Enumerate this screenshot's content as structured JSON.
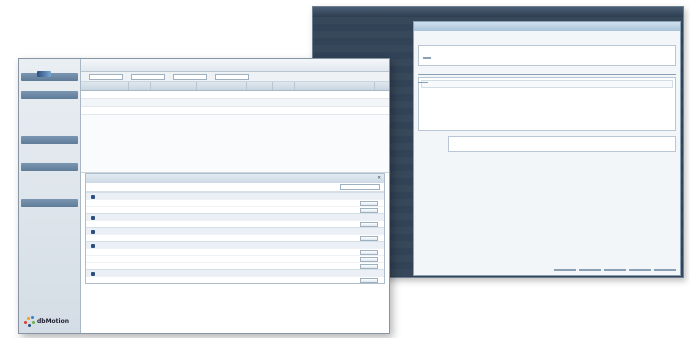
{
  "back_window": {
    "app_title": "",
    "dialog": {
      "title": "",
      "patient_header": "",
      "author_header": "",
      "patient_fields": [],
      "author_fields": [],
      "fields": [],
      "history_header": "",
      "history_lines": [],
      "history_button": "",
      "tab_label": "",
      "reply_header": "",
      "reply_text": "",
      "note_label": "",
      "buttons": [
        "",
        "",
        "",
        "",
        ""
      ]
    }
  },
  "front_window": {
    "title": "",
    "links": [
      "",
      "",
      ""
    ],
    "sidebar": {
      "items": [
        {
          "label": "",
          "style": "sec"
        },
        {
          "label": "",
          "style": "plain"
        },
        {
          "label": "",
          "style": "sec"
        },
        {
          "label": "",
          "style": "plain"
        },
        {
          "label": "",
          "style": "plain"
        },
        {
          "label": "",
          "style": "plain"
        },
        {
          "label": "",
          "style": "plain"
        },
        {
          "label": "",
          "style": "sec"
        },
        {
          "label": "",
          "style": "plain"
        },
        {
          "label": "",
          "style": "plain"
        },
        {
          "label": "",
          "style": "sec"
        },
        {
          "label": "",
          "style": "plain"
        },
        {
          "label": "",
          "style": "plain"
        },
        {
          "label": "",
          "style": "plain"
        },
        {
          "label": "",
          "style": "sec"
        },
        {
          "label": "",
          "style": "plain"
        }
      ],
      "brand": "dbMotion"
    },
    "filters": {
      "labels": [
        "",
        "",
        "",
        ""
      ],
      "values": [
        "",
        "",
        "",
        ""
      ]
    },
    "grid": {
      "columns": [
        "",
        "",
        "",
        "",
        "",
        "",
        ""
      ],
      "rows": [
        [
          "",
          "",
          "",
          "",
          "",
          "",
          ""
        ],
        [
          "",
          "",
          "",
          "",
          "",
          "",
          ""
        ],
        [
          "",
          "",
          "",
          "",
          "",
          "",
          ""
        ]
      ]
    },
    "messages": {
      "title": "",
      "filter_value": "",
      "groups": [
        {
          "header": "",
          "lines": [
            {
              "date": "",
              "text": "",
              "red": false,
              "action": ""
            },
            {
              "date": "",
              "text": "",
              "red": false,
              "action": ""
            }
          ]
        },
        {
          "header": "",
          "lines": [
            {
              "date": "",
              "text": "",
              "red": true,
              "action": ""
            }
          ]
        },
        {
          "header": "",
          "lines": [
            {
              "date": "",
              "text": "",
              "red": true,
              "action": ""
            }
          ]
        },
        {
          "header": "",
          "lines": [
            {
              "date": "",
              "text": "",
              "red": false,
              "action": ""
            },
            {
              "date": "",
              "text": "",
              "red": false,
              "action": ""
            },
            {
              "date": "",
              "text": "",
              "red": false,
              "action": ""
            }
          ]
        },
        {
          "header": "",
          "lines": [
            {
              "date": "",
              "text": "",
              "red": true,
              "action": ""
            }
          ]
        }
      ]
    }
  },
  "colors": {
    "sidebar_section": "#6a86a3",
    "accent_blue": "#2c4f80",
    "alert_red": "#b02a2a",
    "brand_dots": [
      "#e03a2f",
      "#f2a21f",
      "#3a7fc4",
      "#6cb14a",
      "#2c4f80"
    ]
  },
  "icons": {
    "message_group": "envelope-icon",
    "row_flag": "flag-icon"
  }
}
